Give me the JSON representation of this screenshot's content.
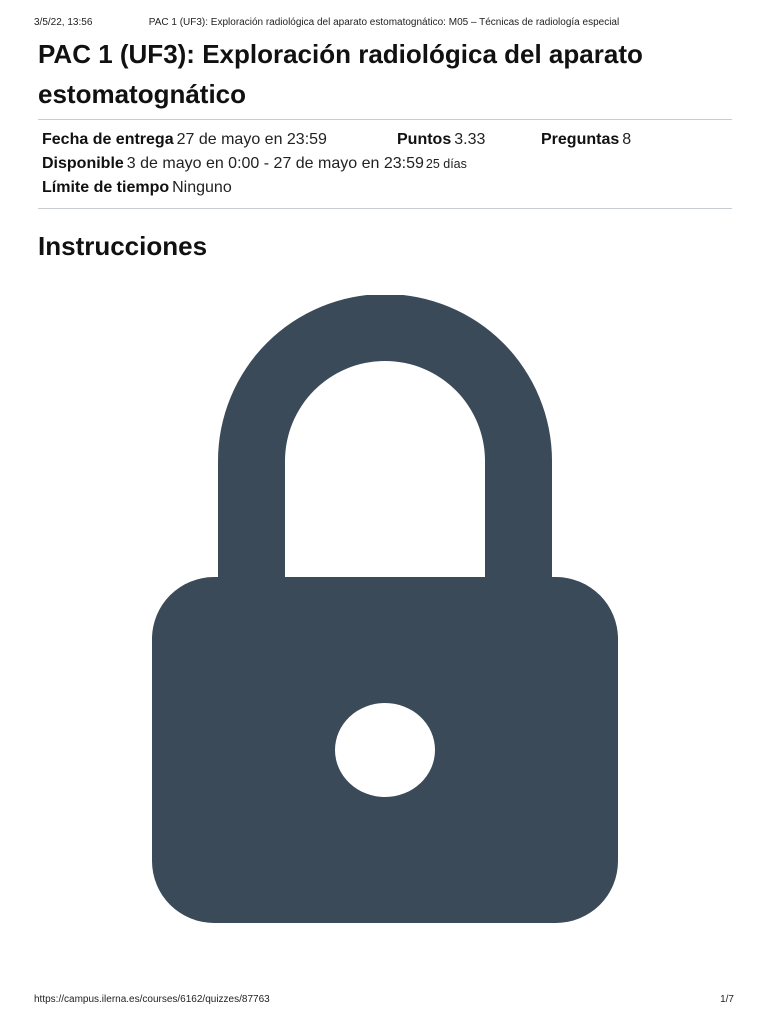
{
  "print_header": {
    "datetime": "3/5/22, 13:56",
    "document_title": "PAC 1 (UF3): Exploración radiológica del aparato estomatognático: M05 – Técnicas de radiología especial"
  },
  "quiz": {
    "title": "PAC 1 (UF3): Exploración radiológica del aparato estomatognático",
    "details": {
      "due_label": "Fecha de entrega",
      "due_value": "27 de mayo en 23:59",
      "points_label": "Puntos",
      "points_value": "3.33",
      "questions_label": "Preguntas",
      "questions_value": "8",
      "available_label": "Disponible",
      "available_value": "3 de mayo en 0:00 - 27 de mayo en 23:59",
      "available_days": "25 días",
      "time_limit_label": "Límite de tiempo",
      "time_limit_value": "Ninguno"
    }
  },
  "instructions": {
    "heading": "Instrucciones",
    "icon": "lock-icon",
    "icon_color": "#3a4a58"
  },
  "print_footer": {
    "url": "https://campus.ilerna.es/courses/6162/quizzes/87763",
    "page": "1/7"
  }
}
